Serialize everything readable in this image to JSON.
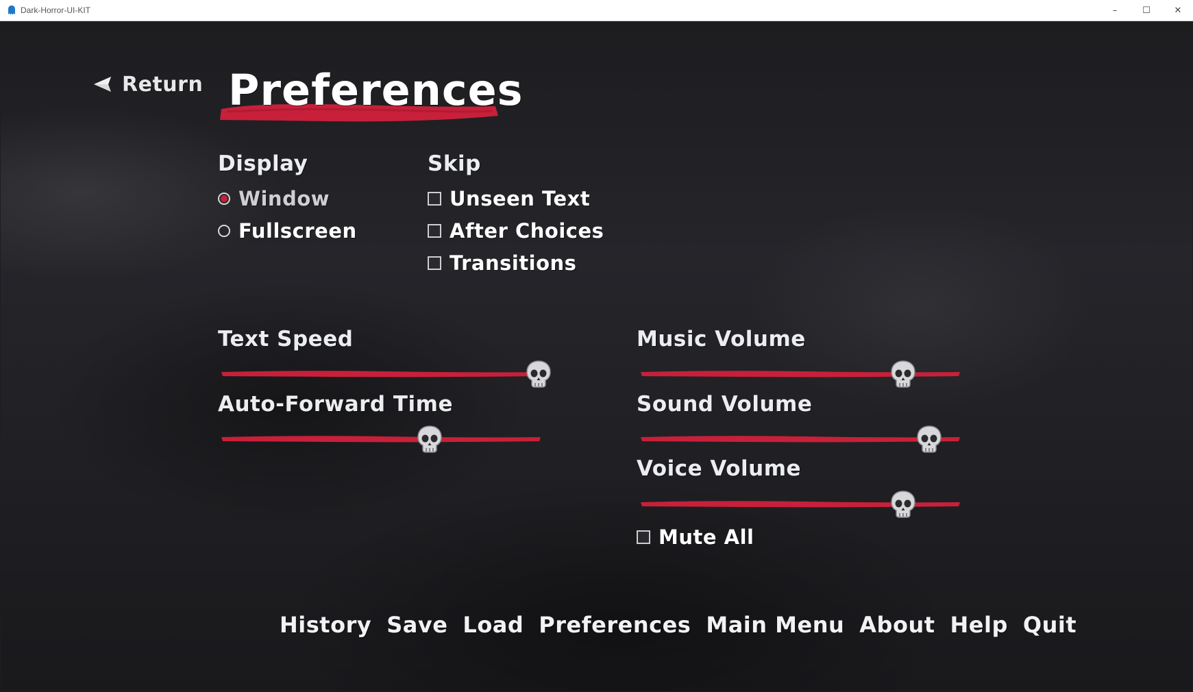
{
  "window": {
    "title": "Dark-Horror-UI-KIT",
    "minimize_symbol": "–",
    "maximize_symbol": "☐",
    "close_symbol": "✕"
  },
  "header": {
    "return_label": "Return",
    "title": "Preferences"
  },
  "display": {
    "heading": "Display",
    "options": [
      {
        "label": "Window",
        "selected": true
      },
      {
        "label": "Fullscreen",
        "selected": false
      }
    ]
  },
  "skip": {
    "heading": "Skip",
    "options": [
      {
        "label": "Unseen Text",
        "checked": false
      },
      {
        "label": "After Choices",
        "checked": false
      },
      {
        "label": "Transitions",
        "checked": false
      }
    ]
  },
  "sliders": {
    "text_speed": {
      "label": "Text Speed",
      "value": 0.99
    },
    "auto_forward": {
      "label": "Auto-Forward Time",
      "value": 0.65
    },
    "music_volume": {
      "label": "Music Volume",
      "value": 0.82
    },
    "sound_volume": {
      "label": "Sound Volume",
      "value": 0.9
    },
    "voice_volume": {
      "label": "Voice Volume",
      "value": 0.82
    }
  },
  "mute_all": {
    "label": "Mute All",
    "checked": false
  },
  "nav": {
    "history": "History",
    "save": "Save",
    "load": "Load",
    "preferences": "Preferences",
    "main_menu": "Main Menu",
    "about": "About",
    "help": "Help",
    "quit": "Quit"
  },
  "colors": {
    "accent": "#c8203a",
    "text": "#ffffff",
    "background": "#1e1e21"
  },
  "icons": {
    "app": "ghost-icon",
    "return": "back-triangle-icon",
    "slider_thumb": "skull-icon"
  }
}
